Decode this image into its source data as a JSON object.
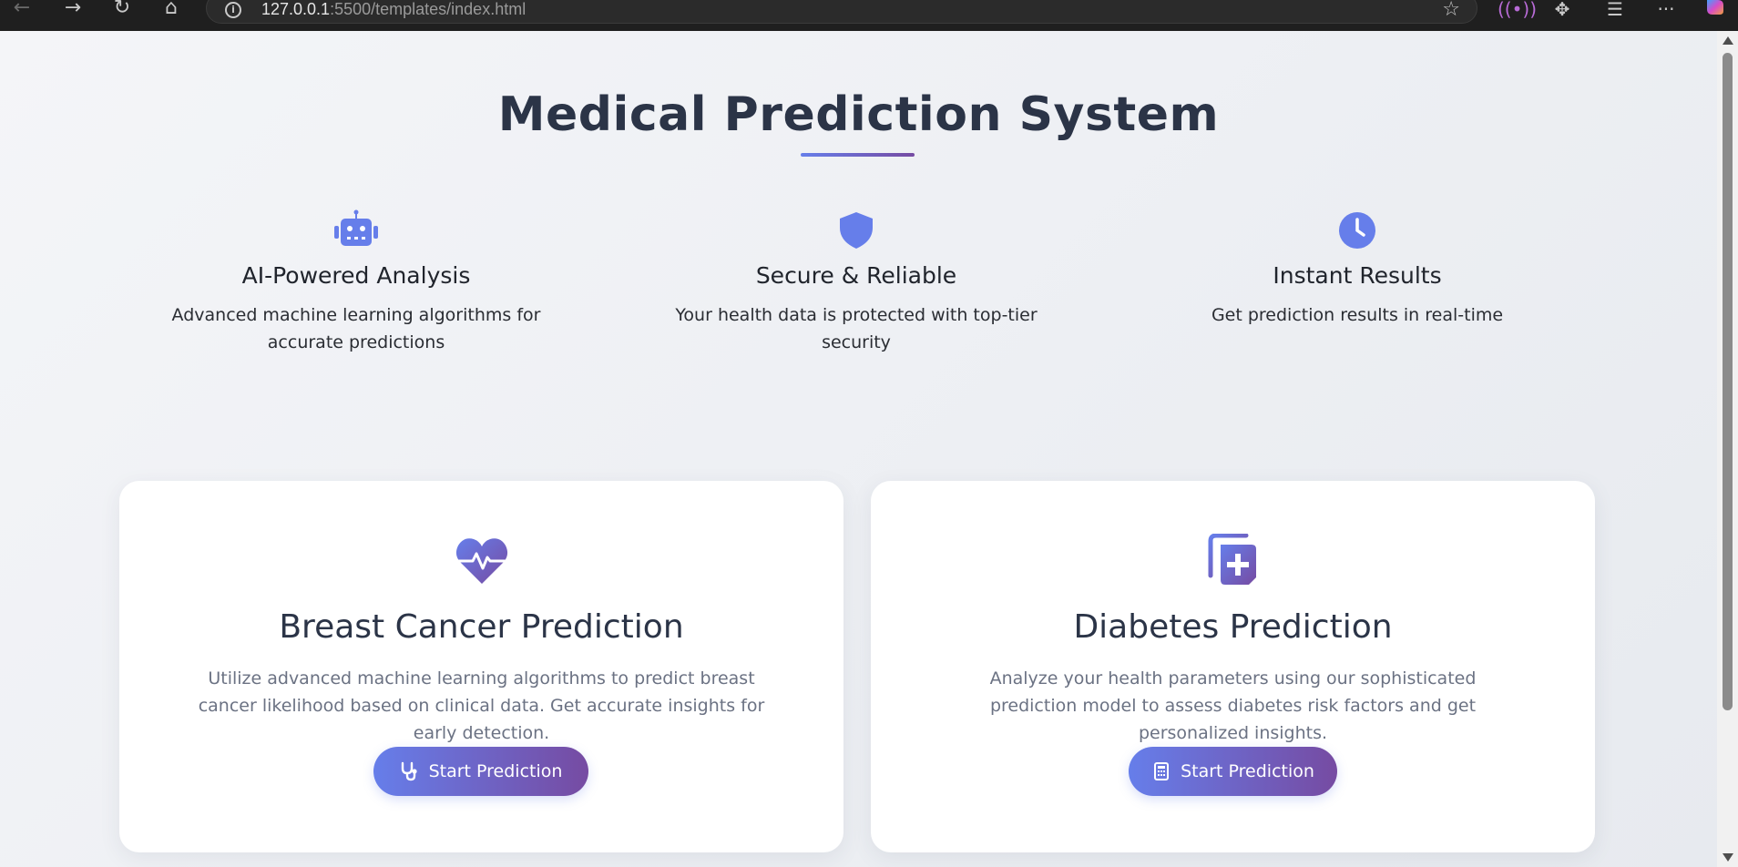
{
  "browser": {
    "url_host": "127.0.0.1",
    "url_path": ":5500/templates/index.html"
  },
  "page": {
    "title": "Medical Prediction System",
    "features": [
      {
        "icon": "robot-icon",
        "title": "AI-Powered Analysis",
        "description": "Advanced machine learning algorithms for accurate predictions"
      },
      {
        "icon": "shield-icon",
        "title": "Secure & Reliable",
        "description": "Your health data is protected with top-tier security"
      },
      {
        "icon": "clock-icon",
        "title": "Instant Results",
        "description": "Get prediction results in real-time"
      }
    ],
    "cards": [
      {
        "icon": "heart-pulse-icon",
        "title": "Breast Cancer Prediction",
        "description": "Utilize advanced machine learning algorithms to predict breast cancer likelihood based on clinical data. Get accurate insights for early detection.",
        "button_icon": "stethoscope-icon",
        "button_label": "Start Prediction"
      },
      {
        "icon": "notes-medical-icon",
        "title": "Diabetes Prediction",
        "description": "Analyze your health parameters using our sophisticated prediction model to assess diabetes risk factors and get personalized insights.",
        "button_icon": "calculator-icon",
        "button_label": "Start Prediction"
      }
    ]
  },
  "colors": {
    "accent_start": "#667eea",
    "accent_end": "#764ba2",
    "title": "#2b3447"
  }
}
